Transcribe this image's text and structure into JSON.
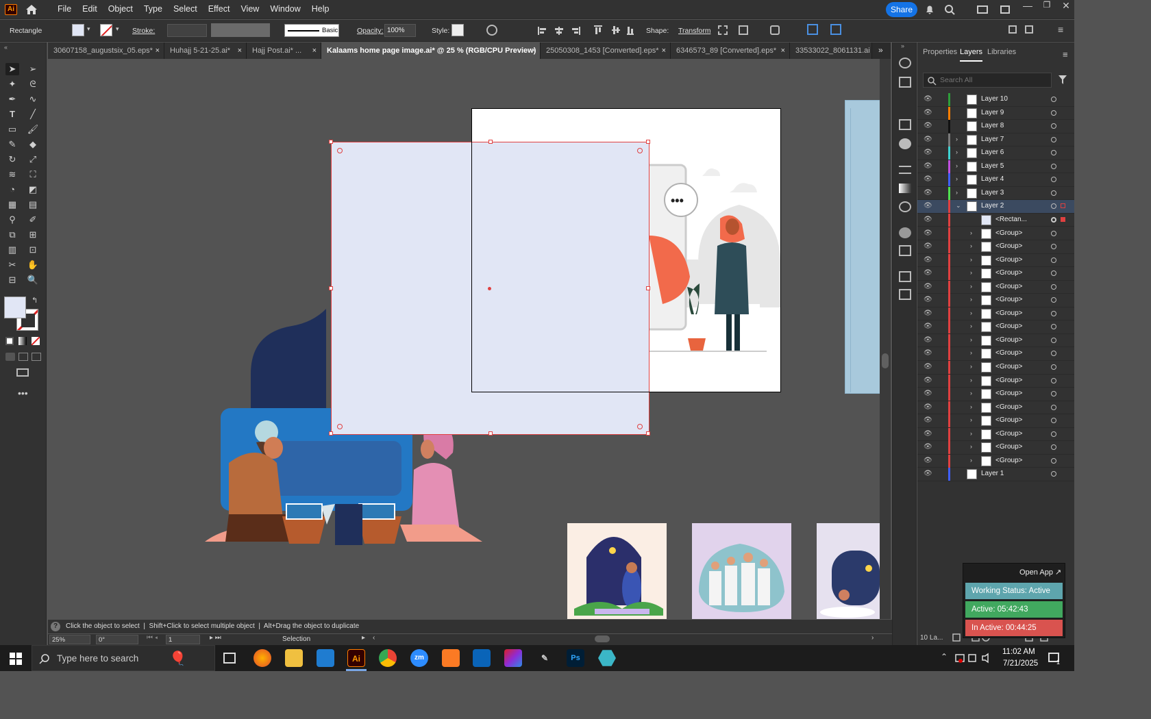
{
  "app": {
    "logo": "Ai",
    "menu": [
      "File",
      "Edit",
      "Object",
      "Type",
      "Select",
      "Effect",
      "View",
      "Window",
      "Help"
    ],
    "share_label": "Share"
  },
  "control": {
    "object_type": "Rectangle",
    "stroke_label": "Stroke:",
    "stroke_style": "Basic",
    "opacity_label": "Opacity:",
    "opacity_value": "100%",
    "style_label": "Style:",
    "shape_label": "Shape:",
    "transform_label": "Transform"
  },
  "tabs": [
    {
      "label": "30607158_augustsix_05.eps*",
      "active": false
    },
    {
      "label": "Huhajj 5-21-25.ai*",
      "active": false
    },
    {
      "label": "Hajj Post.ai* ...",
      "active": false
    },
    {
      "label": "Kalaams home page image.ai* @ 25 % (RGB/CPU Preview)",
      "active": true
    },
    {
      "label": "25050308_1453 [Converted].eps*",
      "active": false
    },
    {
      "label": "6346573_89 [Converted].eps*",
      "active": false
    },
    {
      "label": "33533022_8061131.ai",
      "active": false
    }
  ],
  "panel": {
    "tabs": [
      "Properties",
      "Layers",
      "Libraries"
    ],
    "active_tab": "Layers",
    "search_placeholder": "Search All",
    "footer": "10 La...",
    "layers": [
      {
        "name": "Layer 10",
        "color": "#2e9e3a",
        "level": 0,
        "expand": ""
      },
      {
        "name": "Layer 9",
        "color": "#ff7f00",
        "level": 0,
        "expand": ""
      },
      {
        "name": "Layer 8",
        "color": "#111111",
        "level": 0,
        "expand": ""
      },
      {
        "name": "Layer 7",
        "color": "#7a7a7a",
        "level": 0,
        "expand": "›"
      },
      {
        "name": "Layer 6",
        "color": "#3fd3d3",
        "level": 0,
        "expand": "›"
      },
      {
        "name": "Layer 5",
        "color": "#c050e0",
        "level": 0,
        "expand": "›"
      },
      {
        "name": "Layer 4",
        "color": "#4060ff",
        "level": 0,
        "expand": "›"
      },
      {
        "name": "Layer 3",
        "color": "#50e050",
        "level": 0,
        "expand": "›"
      },
      {
        "name": "Layer 2",
        "color": "#e04040",
        "level": 0,
        "expand": "⌄",
        "selected": true
      },
      {
        "name": "<Rectan...",
        "color": "#e04040",
        "level": 1,
        "expand": ""
      },
      {
        "name": "<Group>",
        "color": "#e04040",
        "level": 1,
        "expand": "›"
      },
      {
        "name": "<Group>",
        "color": "#e04040",
        "level": 1,
        "expand": "›"
      },
      {
        "name": "<Group>",
        "color": "#e04040",
        "level": 1,
        "expand": "›"
      },
      {
        "name": "<Group>",
        "color": "#e04040",
        "level": 1,
        "expand": "›"
      },
      {
        "name": "<Group>",
        "color": "#e04040",
        "level": 1,
        "expand": "›"
      },
      {
        "name": "<Group>",
        "color": "#e04040",
        "level": 1,
        "expand": "›"
      },
      {
        "name": "<Group>",
        "color": "#e04040",
        "level": 1,
        "expand": "›"
      },
      {
        "name": "<Group>",
        "color": "#e04040",
        "level": 1,
        "expand": "›"
      },
      {
        "name": "<Group>",
        "color": "#e04040",
        "level": 1,
        "expand": "›"
      },
      {
        "name": "<Group>",
        "color": "#e04040",
        "level": 1,
        "expand": "›"
      },
      {
        "name": "<Group>",
        "color": "#e04040",
        "level": 1,
        "expand": "›"
      },
      {
        "name": "<Group>",
        "color": "#e04040",
        "level": 1,
        "expand": "›"
      },
      {
        "name": "<Group>",
        "color": "#e04040",
        "level": 1,
        "expand": "›"
      },
      {
        "name": "<Group>",
        "color": "#e04040",
        "level": 1,
        "expand": "›"
      },
      {
        "name": "<Group>",
        "color": "#e04040",
        "level": 1,
        "expand": "›"
      },
      {
        "name": "<Group>",
        "color": "#e04040",
        "level": 1,
        "expand": "›"
      },
      {
        "name": "<Group>",
        "color": "#e04040",
        "level": 1,
        "expand": "›"
      },
      {
        "name": "<Group>",
        "color": "#e04040",
        "level": 1,
        "expand": "›"
      },
      {
        "name": "Layer 1",
        "color": "#4060ff",
        "level": 0,
        "expand": ""
      }
    ]
  },
  "status": {
    "hint": "Click the object to select  |  Shift+Click to select multiple object  |  Alt+Drag the object to duplicate",
    "zoom": "25%",
    "rotate": "0°",
    "artboard": "1",
    "tool": "Selection"
  },
  "tracker": {
    "open_app": "Open App ↗",
    "working": "Working Status: Active",
    "active": "Active: 05:42:43",
    "inactive": "In Active: 00:44:25"
  },
  "taskbar": {
    "search_placeholder": "Type here to search",
    "time": "11:02 AM",
    "date": "7/21/2025",
    "notif_count": "1"
  },
  "canvas": {
    "speech_bubble": "•••"
  }
}
